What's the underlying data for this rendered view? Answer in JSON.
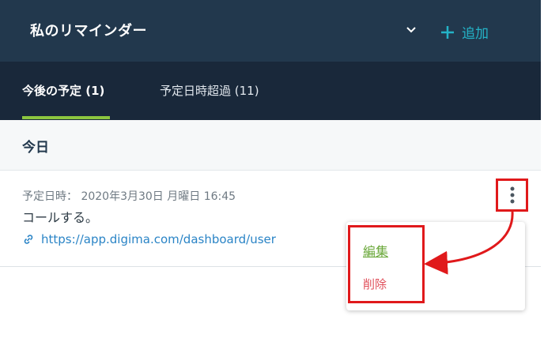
{
  "header": {
    "title": "私のリマインダー",
    "add_label": "追加",
    "icons": {
      "chevron": "chevron-down-icon",
      "add": "plus-icon"
    }
  },
  "tabs": [
    {
      "label": "今後の予定 (1)",
      "active": true
    },
    {
      "label": "予定日時超過 (11)",
      "active": false
    }
  ],
  "section": {
    "label": "今日"
  },
  "reminder": {
    "due": "予定日時： 2020年3月30日 月曜日 16:45",
    "text": "コールする。",
    "link": "https://app.digima.com/dashboard/user"
  },
  "menu": {
    "edit": "編集",
    "delete": "削除"
  },
  "colors": {
    "header_bg": "#22384d",
    "tabs_bg": "#19283a",
    "accent_green": "#8cc63f",
    "add_cyan": "#24b3c7",
    "highlight_red": "#e0191b",
    "link_blue": "#2a84c6",
    "delete_red": "#e0505b"
  }
}
